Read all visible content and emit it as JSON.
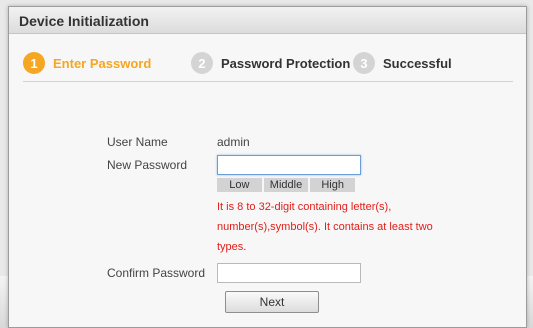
{
  "dialog": {
    "title": "Device Initialization"
  },
  "steps": [
    {
      "number": "1",
      "label": "Enter Password",
      "state": "active"
    },
    {
      "number": "2",
      "label": "Password Protection",
      "state": "inactive"
    },
    {
      "number": "3",
      "label": "Successful",
      "state": "inactive"
    }
  ],
  "form": {
    "username_label": "User Name",
    "username_value": "admin",
    "new_password_label": "New Password",
    "new_password_value": "",
    "strength_levels": [
      "Low",
      "Middle",
      "High"
    ],
    "hint_lines": [
      "It is 8 to 32-digit containing letter(s),",
      "number(s),symbol(s). It contains at least two",
      "types."
    ],
    "confirm_password_label": "Confirm Password",
    "confirm_password_value": ""
  },
  "actions": {
    "next_label": "Next"
  },
  "colors": {
    "accent": "#f5a623",
    "hint": "#e0201a"
  }
}
